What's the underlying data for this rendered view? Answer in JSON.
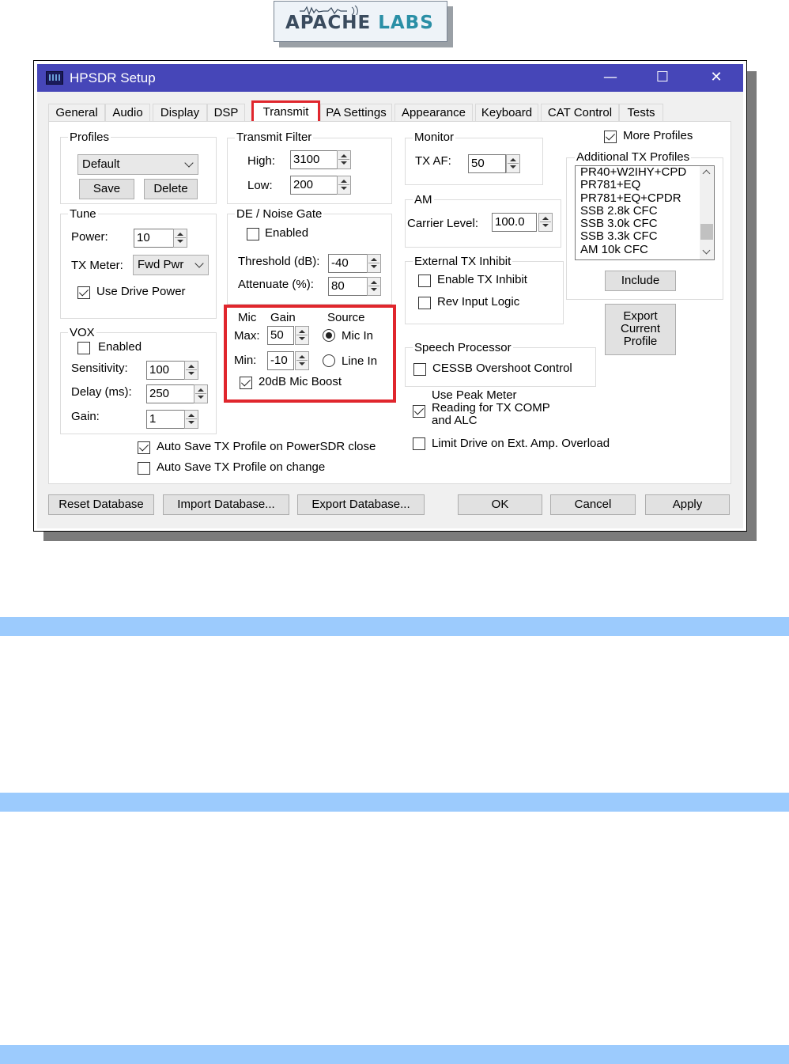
{
  "logo": {
    "text_dark": "APACHE",
    "text_blue": "LABS"
  },
  "window": {
    "title": "HPSDR Setup",
    "minimize": "—",
    "maximize": "☐",
    "close": "✕"
  },
  "tabs": [
    "General",
    "Audio",
    "Display",
    "DSP",
    "Transmit",
    "PA Settings",
    "Appearance",
    "Keyboard",
    "CAT Control",
    "Tests"
  ],
  "profiles": {
    "label": "Profiles",
    "selected": "Default",
    "save": "Save",
    "delete": "Delete"
  },
  "tune": {
    "label": "Tune",
    "power_label": "Power:",
    "power_value": "10",
    "tx_meter_label": "TX Meter:",
    "tx_meter_value": "Fwd Pwr",
    "use_drive_power": "Use Drive Power"
  },
  "vox": {
    "label": "VOX",
    "enabled": "Enabled",
    "sensitivity_label": "Sensitivity:",
    "sensitivity_value": "100",
    "delay_label": "Delay (ms):",
    "delay_value": "250",
    "gain_label": "Gain:",
    "gain_value": "1"
  },
  "transmit_filter": {
    "label": "Transmit Filter",
    "high_label": "High:",
    "high_value": "3100",
    "low_label": "Low:",
    "low_value": "200"
  },
  "noise_gate": {
    "label": "DE / Noise Gate",
    "enabled": "Enabled",
    "threshold_label": "Threshold (dB):",
    "threshold_value": "-40",
    "attenuate_label": "Attenuate (%):",
    "attenuate_value": "80"
  },
  "mic": {
    "mic_label": "Mic",
    "gain_label": "Gain",
    "source_label": "Source",
    "max_label": "Max:",
    "max_value": "50",
    "min_label": "Min:",
    "min_value": "-10",
    "mic_in": "Mic In",
    "line_in": "Line In",
    "boost": "20dB Mic Boost"
  },
  "monitor": {
    "label": "Monitor",
    "txaf_label": "TX AF:",
    "txaf_value": "50"
  },
  "am": {
    "label": "AM",
    "carrier_label": "Carrier Level:",
    "carrier_value": "100.0"
  },
  "ext_inhibit": {
    "label": "External TX Inhibit",
    "enable": "Enable TX Inhibit",
    "rev_logic": "Rev Input Logic"
  },
  "speech": {
    "label": "Speech Processor",
    "cessb": "CESSB Overshoot Control"
  },
  "peak_meter": {
    "line1": "Use Peak Meter",
    "line2": "Reading for TX COMP",
    "line3": "and ALC"
  },
  "limit_drive": "Limit Drive on Ext. Amp. Overload",
  "auto_save_close": "Auto Save TX Profile on PowerSDR close",
  "auto_save_change": "Auto Save TX Profile on change",
  "more_profiles": "More Profiles",
  "additional": {
    "label": "Additional TX Profiles",
    "items": [
      "PR40+W2IHY+CPD",
      "PR781+EQ",
      "PR781+EQ+CPDR",
      "SSB 2.8k CFC",
      "SSB 3.0k CFC",
      "SSB 3.3k CFC",
      "AM 10k CFC"
    ],
    "include": "Include"
  },
  "export_profile": {
    "line1": "Export",
    "line2": "Current",
    "line3": "Profile"
  },
  "bottom": {
    "reset": "Reset Database",
    "import": "Import Database...",
    "export": "Export Database...",
    "ok": "OK",
    "cancel": "Cancel",
    "apply": "Apply"
  },
  "colors": {
    "titlebar": "#4646b8",
    "highlight": "#e0262d",
    "band": "#9ccbfd"
  }
}
